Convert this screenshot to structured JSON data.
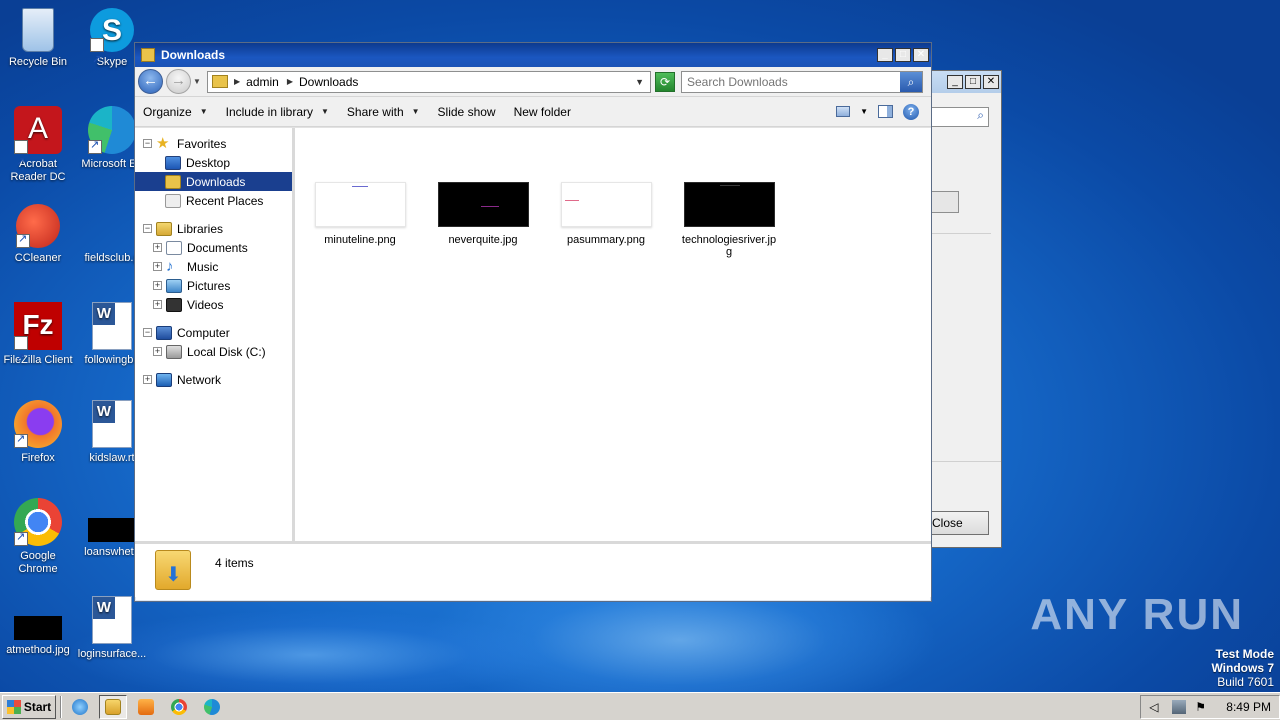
{
  "desktop": {
    "icons": [
      {
        "label": "Recycle Bin",
        "icon": "recycle-bin-icon",
        "color": "#9fc3e8"
      },
      {
        "label": "Skype",
        "icon": "skype-icon",
        "color": "#0d9bde"
      },
      {
        "label": "Acrobat Reader DC",
        "icon": "acrobat-icon",
        "color": "#c4161c"
      },
      {
        "label": "Microsoft Ed",
        "icon": "edge-icon",
        "color": "#1f8ad6"
      },
      {
        "label": "CCleaner",
        "icon": "ccleaner-icon",
        "color": "#d93a2b"
      },
      {
        "label": "fieldsclub.p",
        "icon": "file-icon",
        "color": "#3a6fd1"
      },
      {
        "label": "FileZilla Client",
        "icon": "filezilla-icon",
        "color": "#bf0000"
      },
      {
        "label": "followingbu",
        "icon": "word-doc-icon",
        "color": "#2b5797"
      },
      {
        "label": "Firefox",
        "icon": "firefox-icon",
        "color": "#f2762b"
      },
      {
        "label": "kidslaw.rt",
        "icon": "word-doc-icon",
        "color": "#2b5797"
      },
      {
        "label": "Google Chrome",
        "icon": "chrome-icon",
        "color": "#34a853"
      },
      {
        "label": "loanswheth",
        "icon": "image-file-icon",
        "color": "#000000"
      },
      {
        "label": "atmethod.jpg",
        "icon": "image-file-icon",
        "color": "#000000"
      },
      {
        "label": "loginsurface...",
        "icon": "word-doc-icon",
        "color": "#2b5797"
      }
    ],
    "watermark": "ANY RUN",
    "test_mode": {
      "line1": "Test Mode",
      "line2": "Windows 7",
      "line3": "Build 7601"
    }
  },
  "background_window": {
    "close_button": "Close"
  },
  "explorer": {
    "title": "Downloads",
    "address": {
      "crumbs": [
        "admin",
        "Downloads"
      ]
    },
    "search_placeholder": "Search Downloads",
    "toolbar": {
      "organize": "Organize",
      "include_in_library": "Include in library",
      "share_with": "Share with",
      "slide_show": "Slide show",
      "new_folder": "New folder"
    },
    "nav": {
      "favorites": "Favorites",
      "desktop": "Desktop",
      "downloads": "Downloads",
      "recent_places": "Recent Places",
      "libraries": "Libraries",
      "documents": "Documents",
      "music": "Music",
      "pictures": "Pictures",
      "videos": "Videos",
      "computer": "Computer",
      "local_disk": "Local Disk (C:)",
      "network": "Network"
    },
    "files": [
      {
        "name": "minuteline.png",
        "thumb": "light",
        "accent": "#6a6ad0"
      },
      {
        "name": "neverquite.jpg",
        "thumb": "dark",
        "accent": "#8a2a8a"
      },
      {
        "name": "pasummary.png",
        "thumb": "light",
        "accent": "#e06a8a"
      },
      {
        "name": "technologiesriver.jpg",
        "thumb": "dark",
        "accent": "#3a3a3a"
      }
    ],
    "status": "4 items"
  },
  "taskbar": {
    "start": "Start",
    "clock": "8:49 PM"
  }
}
